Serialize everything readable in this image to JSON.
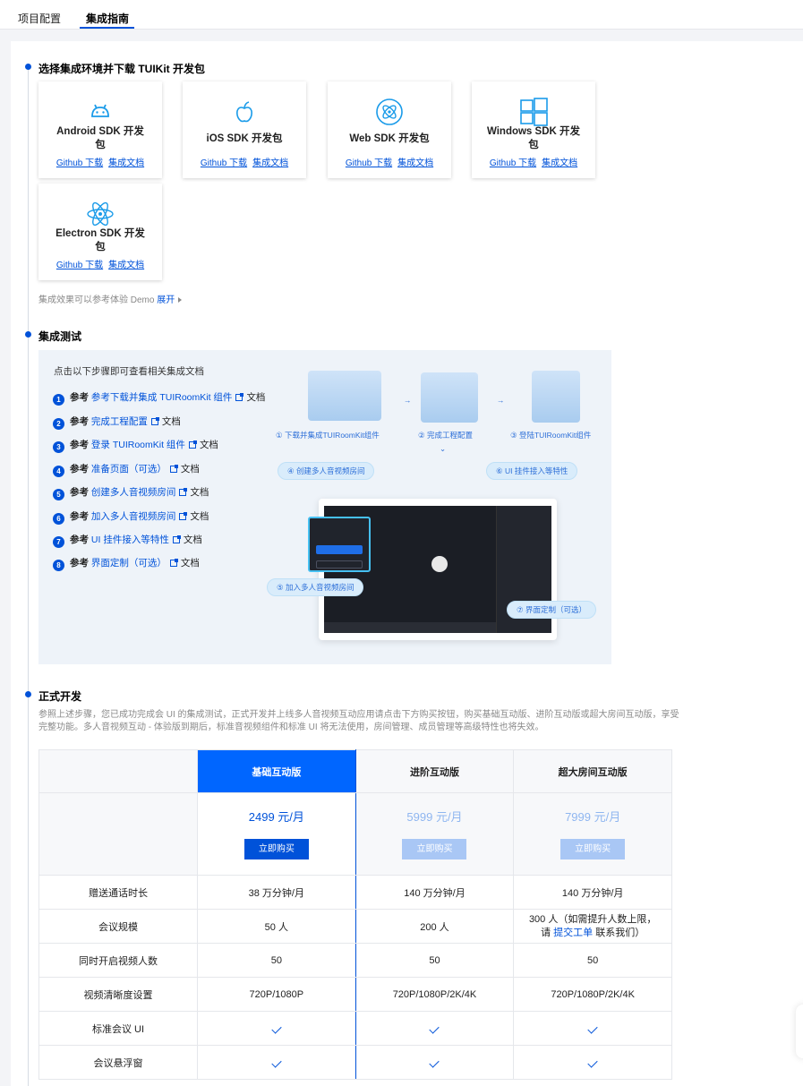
{
  "tabs": [
    {
      "label": "项目配置"
    },
    {
      "label": "集成指南"
    }
  ],
  "section1": {
    "title": "选择集成环境并下载 TUIKit 开发包",
    "sdks": [
      {
        "name_line1": "Android SDK 开发",
        "name_line2": "包",
        "github": "Github 下载",
        "docs": "集成文档",
        "icon": "android-icon"
      },
      {
        "name_line1": "iOS SDK 开发包",
        "name_line2": "",
        "github": "Github 下载",
        "docs": "集成文档",
        "icon": "apple-icon"
      },
      {
        "name_line1": "Web SDK 开发包",
        "name_line2": "",
        "github": "Github 下载",
        "docs": "集成文档",
        "icon": "web-icon"
      },
      {
        "name_line1": "Windows SDK 开发",
        "name_line2": "包",
        "github": "Github 下载",
        "docs": "集成文档",
        "icon": "windows-icon"
      },
      {
        "name_line1": "Electron SDK 开发",
        "name_line2": "包",
        "github": "Github 下载",
        "docs": "集成文档",
        "icon": "electron-icon"
      }
    ],
    "demo_text": "集成效果可以参考体验 Demo",
    "demo_link": "展开"
  },
  "section2": {
    "title": "集成测试",
    "head": "点击以下步骤即可查看相关集成文档",
    "steps": [
      {
        "num": "1",
        "pre": "参考",
        "link": "参考下载并集成 TUIRoomKit 组件",
        "post": "文档"
      },
      {
        "num": "2",
        "pre": "参考",
        "link": "完成工程配置",
        "post": "文档"
      },
      {
        "num": "3",
        "pre": "参考",
        "link": "登录 TUIRoomKit 组件",
        "post": "文档"
      },
      {
        "num": "4",
        "pre": "参考",
        "link": "准备页面（可选）",
        "post": "文档"
      },
      {
        "num": "5",
        "pre": "参考",
        "link": "创建多人音视频房间",
        "post": "文档"
      },
      {
        "num": "6",
        "pre": "参考",
        "link": "加入多人音视频房间",
        "post": "文档"
      },
      {
        "num": "7",
        "pre": "参考",
        "link": "UI 挂件接入等特性",
        "post": "文档"
      },
      {
        "num": "8",
        "pre": "参考",
        "link": "界面定制（可选）",
        "post": "文档"
      }
    ],
    "diagram": {
      "flow1": "① 下载并集成TUIRoomKit组件",
      "flow2": "② 完成工程配置",
      "flow3": "③ 登陆TUIRoomKit组件",
      "pill4": "④ 创建多人音视频房间",
      "pill5": "⑤ 加入多人音视频房间",
      "pill6": "⑥ UI 挂件接入等特性",
      "pill7": "⑦ 界面定制（可选）"
    }
  },
  "section3": {
    "title": "正式开发",
    "desc": "参照上述步骤，您已成功完成会 UI 的集成测试，正式开发并上线多人音视频互动应用请点击下方购买按钮，购买基础互动版、进阶互动版或超大房间互动版，享受完整功能。多人音视频互动 - 体验版到期后，标准音视频组件和标准 UI 将无法使用，房间管理、成员管理等高级特性也将失效。",
    "plans": [
      {
        "name": "基础互动版",
        "price": "2499 元/月",
        "buy": "立即购买"
      },
      {
        "name": "进阶互动版",
        "price": "5999 元/月",
        "buy": "立即购买"
      },
      {
        "name": "超大房间互动版",
        "price": "7999 元/月",
        "buy": "立即购买"
      }
    ],
    "rows": [
      {
        "feature": "赠送通话时长",
        "v": [
          "38 万分钟/月",
          "140 万分钟/月",
          "140 万分钟/月"
        ]
      },
      {
        "feature": "会议规模",
        "v": [
          "50 人",
          "200 人",
          "300 人（如需提升人数上限，"
        ],
        "extra_pre": "请",
        "extra_link": "提交工单",
        "extra_post": "联系我们）"
      },
      {
        "feature": "同时开启视频人数",
        "v": [
          "50",
          "50",
          "50"
        ]
      },
      {
        "feature": "视频清晰度设置",
        "v": [
          "720P/1080P",
          "720P/1080P/2K/4K",
          "720P/1080P/2K/4K"
        ]
      },
      {
        "feature": "标准会议 UI",
        "v": [
          "check",
          "check",
          "check"
        ]
      },
      {
        "feature": "会议悬浮窗",
        "v": [
          "check",
          "check",
          "check"
        ]
      }
    ]
  },
  "colors": {
    "accent": "#0052d9",
    "highlight": "#0066ff",
    "cyan": "#46c0f2"
  }
}
